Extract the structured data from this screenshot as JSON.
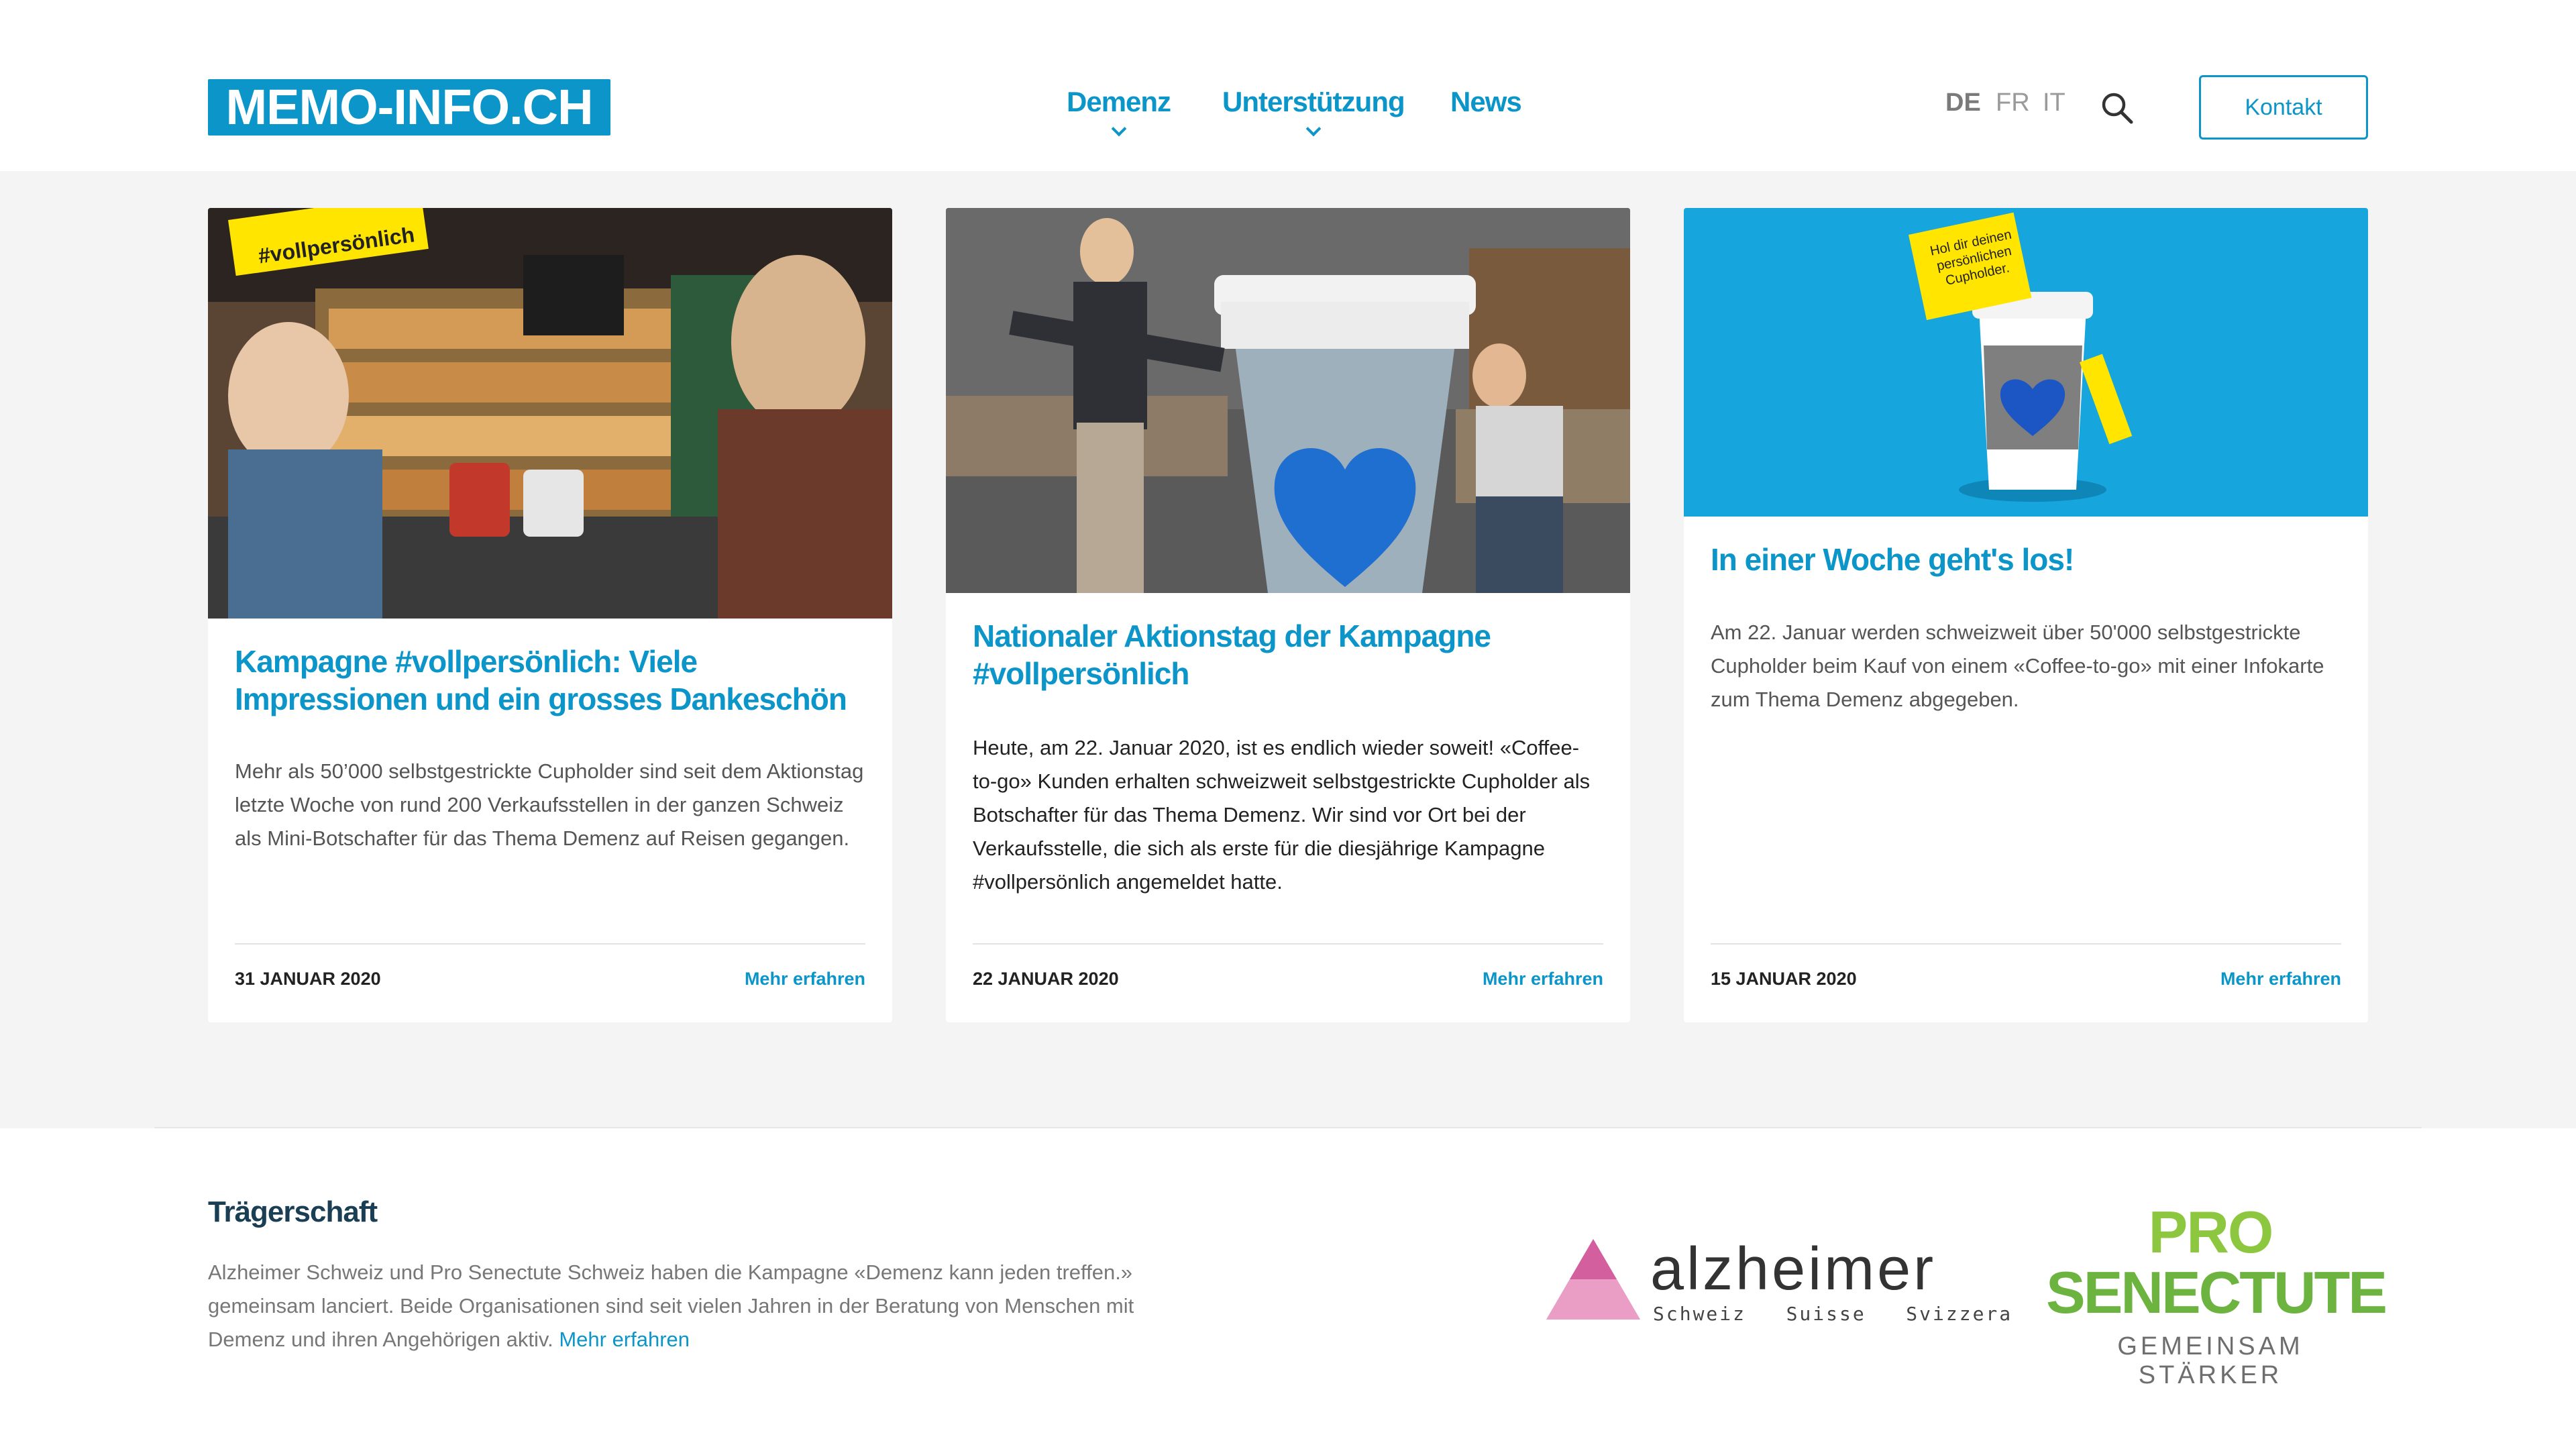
{
  "header": {
    "logo": "MEMO-INFO.CH",
    "nav": [
      {
        "label": "Demenz",
        "has_dropdown": true
      },
      {
        "label": "Unterstützung",
        "has_dropdown": true
      },
      {
        "label": "News",
        "has_dropdown": false
      }
    ],
    "languages": [
      {
        "code": "DE",
        "active": true
      },
      {
        "code": "FR",
        "active": false
      },
      {
        "code": "IT",
        "active": false
      }
    ],
    "search_icon": "search-icon",
    "contact_button": "Kontakt"
  },
  "cards": [
    {
      "image_tag": "#vollpersönlich",
      "title": "Kampagne #vollpersönlich: Viele Impressionen und ein grosses Dankeschön",
      "text": "Mehr als 50’000 selbstgestrickte Cupholder sind seit dem Aktionstag letzte Woche von rund 200 Verkaufsstellen in der ganzen Schweiz als Mini-Botschafter für das Thema Demenz auf Reisen gegangen.",
      "date": "31 JANUAR 2020",
      "more": "Mehr erfahren"
    },
    {
      "title": "Nationaler Aktionstag der Kampagne #vollpersönlich",
      "text": "Heute, am 22. Januar 2020, ist es endlich wieder soweit! «Coffee-to-go» Kunden erhalten schweizweit selbstgestrickte Cupholder als Botschafter für das Thema Demenz. Wir sind vor Ort bei der Verkaufsstelle, die sich als erste für die diesjährige Kampagne #vollpersönlich angemeldet hatte.",
      "date": "22 JANUAR 2020",
      "more": "Mehr erfahren"
    },
    {
      "image_note": "Hol dir deinen persönlichen Cupholder.",
      "title": "In einer Woche geht's los!",
      "text": "Am 22. Januar werden schweizweit über 50'000 selbstgestrickte Cupholder beim Kauf von einem «Coffee-to-go» mit einer Infokarte zum Thema Demenz abgegeben.",
      "date": "15 JANUAR 2020",
      "more": "Mehr erfahren"
    }
  ],
  "footer": {
    "title": "Trägerschaft",
    "text": "Alzheimer Schweiz und Pro Senectute Schweiz haben die Kampagne «Demenz kann jeden treffen.» gemeinsam lanciert. Beide Organisationen sind seit vielen Jahren in der Beratung von Menschen mit Demenz und ihren Angehörigen aktiv.",
    "link": "Mehr erfahren",
    "alzheimer": {
      "name": "alzheimer",
      "sub": "Schweiz   Suisse   Svizzera"
    },
    "prosenectute": {
      "line1": "PRO",
      "line2": "SENECTUTE",
      "line3": "GEMEINSAM STÄRKER"
    }
  },
  "colors": {
    "accent": "#0b95c9",
    "background": "#f4f4f4",
    "footer_heading": "#1a3f55"
  }
}
